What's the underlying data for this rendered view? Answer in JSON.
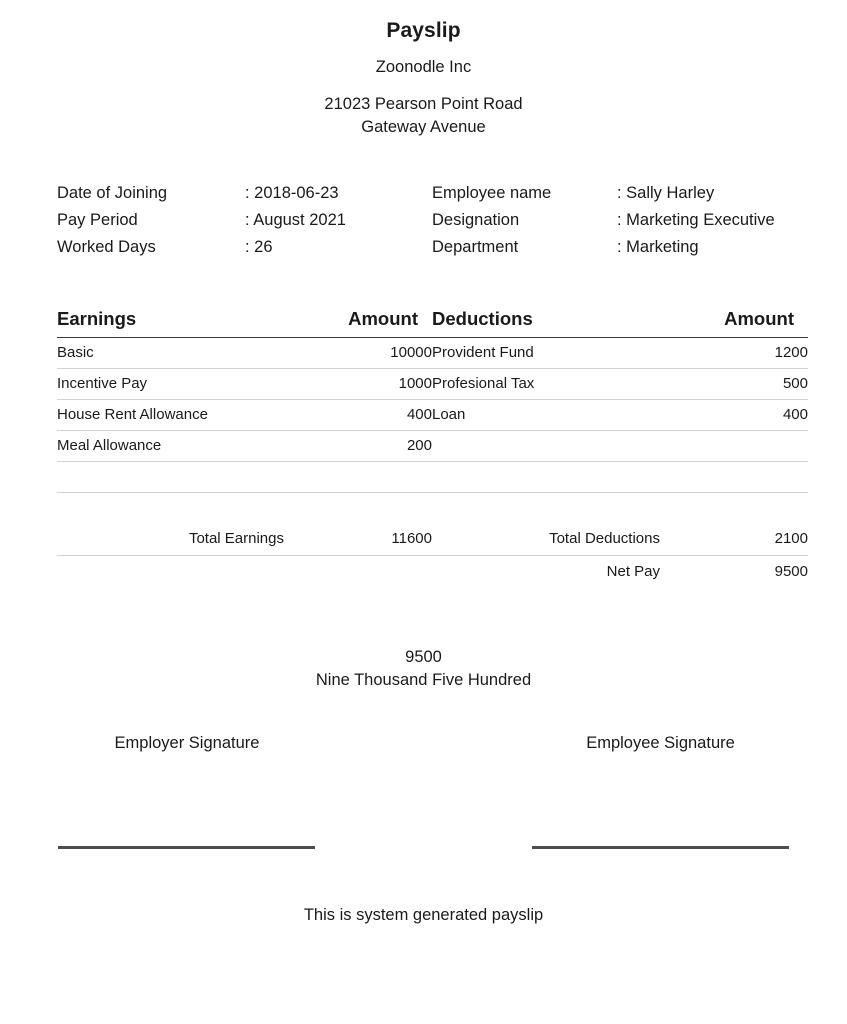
{
  "document": {
    "title": "Payslip",
    "company_name": "Zoonodle Inc",
    "address_line1": "21023 Pearson Point Road",
    "address_line2": "Gateway Avenue"
  },
  "details": {
    "left": [
      {
        "label": "Date of Joining",
        "value": ": 2018-06-23"
      },
      {
        "label": "Pay Period",
        "value": ": August 2021"
      },
      {
        "label": "Worked Days",
        "value": ": 26"
      }
    ],
    "right": [
      {
        "label": "Employee name",
        "value": ": Sally Harley"
      },
      {
        "label": "Designation",
        "value": ": Marketing Executive"
      },
      {
        "label": "Department",
        "value": ": Marketing"
      }
    ]
  },
  "earnings": {
    "header_name": "Earnings",
    "header_amount": "Amount",
    "rows": [
      {
        "name": "Basic",
        "amount": "10000"
      },
      {
        "name": "Incentive Pay",
        "amount": "1000"
      },
      {
        "name": "House Rent Allowance",
        "amount": "400"
      },
      {
        "name": "Meal Allowance",
        "amount": "200"
      }
    ],
    "total_label": "Total Earnings",
    "total_amount": "11600"
  },
  "deductions": {
    "header_name": "Deductions",
    "header_amount": "Amount",
    "rows": [
      {
        "name": "Provident Fund",
        "amount": "1200"
      },
      {
        "name": "Profesional Tax",
        "amount": "500"
      },
      {
        "name": "Loan",
        "amount": "400"
      }
    ],
    "total_label": "Total Deductions",
    "total_amount": "2100",
    "netpay_label": "Net Pay",
    "netpay_amount": "9500"
  },
  "netpay_summary": {
    "amount": "9500",
    "amount_in_words": "Nine Thousand Five Hundred"
  },
  "signatures": {
    "employer_label": "Employer Signature",
    "employee_label": "Employee Signature"
  },
  "footer": {
    "note": "This is system generated payslip"
  },
  "colors": {
    "text": "#1a1a1a",
    "rule_header": "#3a3a3a",
    "rule_row": "#d2d2d2",
    "signature_line": "#4d4d4d",
    "background": "#ffffff"
  }
}
